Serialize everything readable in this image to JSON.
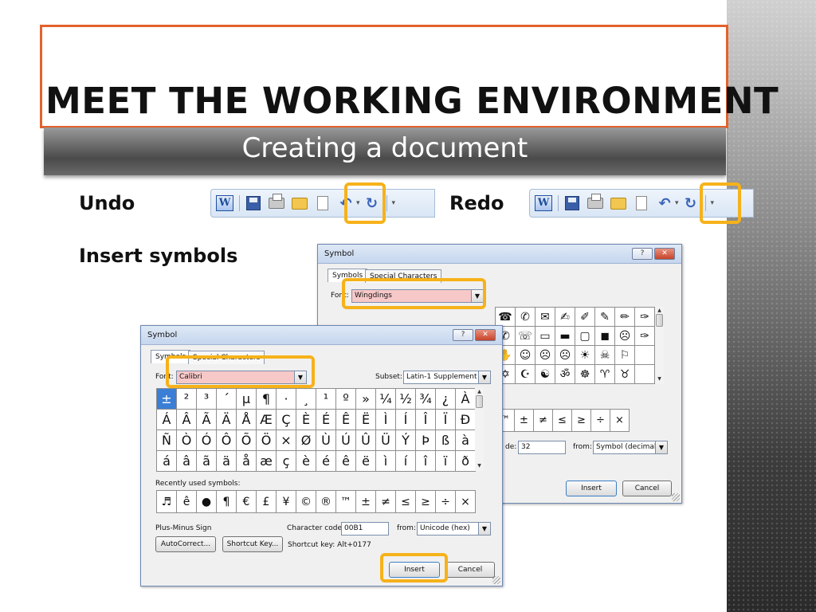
{
  "slide": {
    "title": "MEET THE WORKING ENVIRONMENT",
    "subtitle": "Creating a document",
    "undo_label": "Undo",
    "redo_label": "Redo",
    "insert_symbols_label": "Insert symbols"
  },
  "colors": {
    "title_border": "#e3622c",
    "highlight": "#f6b21a",
    "selected_cell": "#3a7fd5",
    "font_combo_pink": "#f7c8c8"
  },
  "toolbar": {
    "word_icon_glyph": "W",
    "icons": [
      "word-icon",
      "save-icon",
      "print-icon",
      "open-folder-icon",
      "new-document-icon",
      "undo-icon",
      "redo-icon",
      "customize-icon"
    ]
  },
  "back_dialog": {
    "title": "Symbol",
    "help_glyph": "?",
    "close_glyph": "✕",
    "tabs": [
      "Symbols",
      "Special Characters"
    ],
    "font_label": "Font:",
    "font_value": "Wingdings",
    "grid_rows": [
      [
        "☎",
        "✆",
        "✉",
        "✍",
        "✐",
        "✎",
        "✏",
        "✑"
      ],
      [
        "✆",
        "☏",
        "▭",
        "▬",
        "▢",
        "◼",
        "☹",
        "✑"
      ],
      [
        "✋",
        "☺",
        "☹",
        "☹",
        "☀",
        "☠",
        "⚐",
        ""
      ],
      [
        "✡",
        "☪",
        "☯",
        "ॐ",
        "☸",
        "♈",
        "♉",
        ""
      ]
    ],
    "recent_symbols": [
      "™",
      "±",
      "≠",
      "≤",
      "≥",
      "÷",
      "×"
    ],
    "code_label": "de:",
    "code_value": "32",
    "from_label": "from:",
    "from_value": "Symbol (decimal)",
    "insert_label": "Insert",
    "cancel_label": "Cancel"
  },
  "front_dialog": {
    "title": "Symbol",
    "help_glyph": "?",
    "close_glyph": "✕",
    "tabs": [
      "Symbols",
      "Special Characters"
    ],
    "font_label": "Font:",
    "font_value": "Calibri",
    "subset_label": "Subset:",
    "subset_value": "Latin-1 Supplement",
    "grid_rows": [
      [
        "±",
        "²",
        "³",
        "´",
        "µ",
        "¶",
        "·",
        "¸",
        "¹",
        "º",
        "»",
        "¼",
        "½",
        "¾",
        "¿",
        "À"
      ],
      [
        "Á",
        "Â",
        "Ã",
        "Ä",
        "Å",
        "Æ",
        "Ç",
        "È",
        "É",
        "Ê",
        "Ë",
        "Ì",
        "Í",
        "Î",
        "Ï",
        "Ð"
      ],
      [
        "Ñ",
        "Ò",
        "Ó",
        "Ô",
        "Õ",
        "Ö",
        "×",
        "Ø",
        "Ù",
        "Ú",
        "Û",
        "Ü",
        "Ý",
        "Þ",
        "ß",
        "à"
      ],
      [
        "á",
        "â",
        "ã",
        "ä",
        "å",
        "æ",
        "ç",
        "è",
        "é",
        "ê",
        "ë",
        "ì",
        "í",
        "î",
        "ï",
        "ð"
      ]
    ],
    "recent_label": "Recently used symbols:",
    "recent_symbols": [
      "♬",
      "ê",
      "●",
      "¶",
      "€",
      "£",
      "¥",
      "©",
      "®",
      "™",
      "±",
      "≠",
      "≤",
      "≥",
      "÷",
      "×"
    ],
    "symbol_name": "Plus-Minus Sign",
    "char_code_label": "Character code:",
    "char_code_value": "00B1",
    "from_label": "from:",
    "from_value": "Unicode (hex)",
    "autocorrect_label": "AutoCorrect...",
    "shortcut_key_label": "Shortcut Key...",
    "shortcut_text": "Shortcut key: Alt+0177",
    "insert_label": "Insert",
    "cancel_label": "Cancel"
  }
}
